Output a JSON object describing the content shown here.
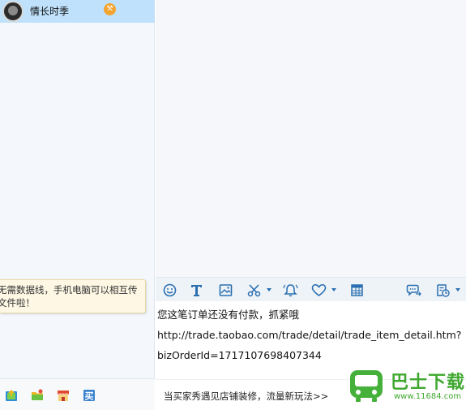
{
  "contact": {
    "name": "情长时季",
    "avatar_icon": "user-avatar",
    "badge_icon": "hammer-badge-icon"
  },
  "tip": {
    "line1": "无需数据线，手机电脑可以相互传",
    "line2": "文件啦！"
  },
  "left_toolbar": {
    "icons": [
      "send-file-icon",
      "folder-icon",
      "shop-icon",
      "buy-icon"
    ]
  },
  "toolbar": {
    "icons": [
      "emoji-icon",
      "font-icon",
      "image-icon",
      "scissors-icon",
      "bell-icon",
      "heart-icon",
      "table-icon",
      "chat-transfer-icon",
      "history-icon"
    ]
  },
  "message": {
    "line1": "您这笔订单还没有付款，抓紧哦",
    "line2": "http://trade.taobao.com/trade/detail/trade_item_detail.htm?",
    "line3": "bizOrderId=1717107698407344"
  },
  "promo": {
    "text": "当买家秀遇见店铺装修，流量新玩法>>"
  },
  "watermark": {
    "title": "巴士下载",
    "url": "www.11684.com"
  },
  "colors": {
    "selected_row": "#bfe1fb",
    "accent_blue": "#2a6fb0",
    "watermark_green": "#3fa82f",
    "tip_bg": "#fdf7e4"
  }
}
